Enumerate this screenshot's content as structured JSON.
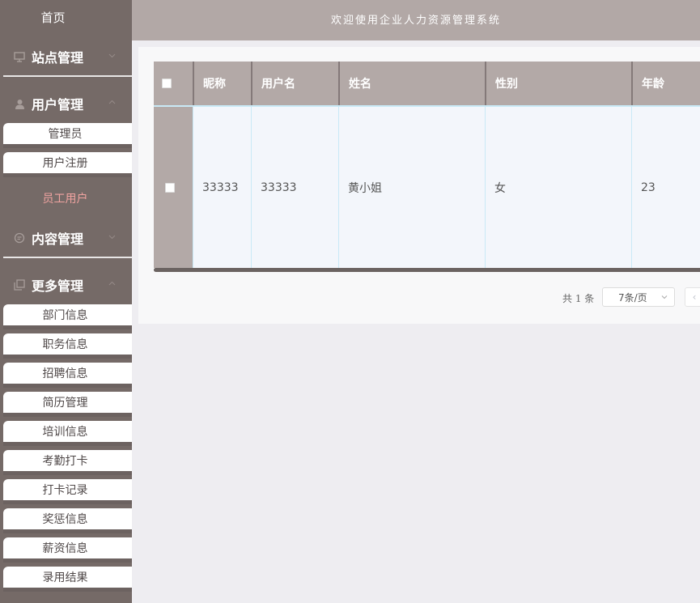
{
  "sidebar": {
    "home_label": "首页",
    "groups": [
      {
        "label": "站点管理",
        "icon": "monitor-icon"
      },
      {
        "label": "用户管理",
        "icon": "user-icon",
        "items": [
          "管理员",
          "用户注册",
          "员工用户"
        ]
      },
      {
        "label": "内容管理",
        "icon": "chat-icon"
      },
      {
        "label": "更多管理",
        "icon": "copy-icon",
        "items": [
          "部门信息",
          "职务信息",
          "招聘信息",
          "简历管理",
          "培训信息",
          "考勤打卡",
          "打卡记录",
          "奖惩信息",
          "薪资信息",
          "录用结果"
        ]
      }
    ],
    "active_item": "员工用户",
    "active_color": "#f0a3a0"
  },
  "header": {
    "title": "欢迎使用企业人力资源管理系统"
  },
  "table": {
    "columns": [
      "昵称",
      "用户名",
      "姓名",
      "性别",
      "年龄"
    ],
    "rows": [
      {
        "nickname": "33333",
        "username": "33333",
        "name": "黄小姐",
        "gender": "女",
        "age": "23"
      }
    ]
  },
  "pagination": {
    "total_text": "共 1 条",
    "page_size": "7条/页",
    "prev": "‹"
  },
  "colors": {
    "sidebar_bg": "#756a67",
    "header_bg": "#b2a8a6",
    "table_header_bg": "#b3a9a7",
    "page_bg": "#eeedf1"
  }
}
